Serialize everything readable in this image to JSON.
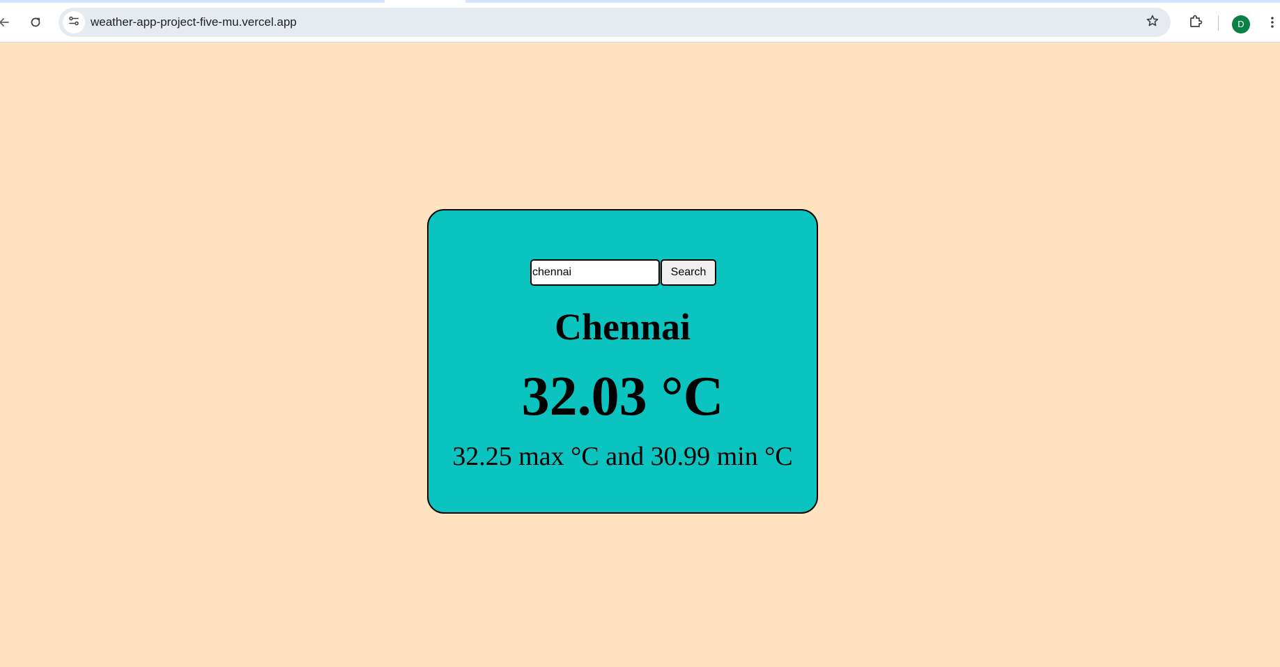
{
  "browser": {
    "url": "weather-app-project-five-mu.vercel.app",
    "profile_initial": "D",
    "icons": {
      "back": "back-arrow-icon",
      "reload": "reload-icon",
      "site_info": "site-info-icon",
      "bookmark": "star-icon",
      "extensions": "puzzle-icon",
      "menu": "three-dot-menu-icon"
    }
  },
  "search": {
    "value": "chennai",
    "button_label": "Search"
  },
  "weather": {
    "city": "Chennai",
    "temperature": "32.03 °C",
    "min_max": "32.25 max °C and 30.99 min °C"
  },
  "colors": {
    "page_background": "#ffe3c0",
    "card_background": "#0bc4c0",
    "avatar": "#0b8043"
  }
}
